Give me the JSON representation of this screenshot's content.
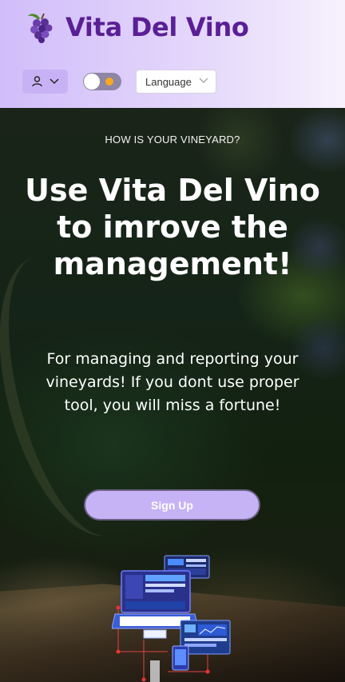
{
  "header": {
    "brand_title": "Vita Del Vino",
    "logo_icon": "grapes-icon",
    "user_menu_icon": "user-icon",
    "theme_toggle_state": "off",
    "language_select": {
      "selected": "Language"
    },
    "colors": {
      "brand": "#5b1f95",
      "accent": "#c6b3f6"
    }
  },
  "hero": {
    "eyebrow": "HOW IS YOUR VINEYARD?",
    "headline": "Use Vita Del Vino to imrove the management!",
    "subtext": "For managing and reporting your vineyards! If you dont use proper tool, you will miss a fortune!",
    "cta_label": "Sign Up",
    "illustration_icon": "dashboard-devices-illustration"
  }
}
